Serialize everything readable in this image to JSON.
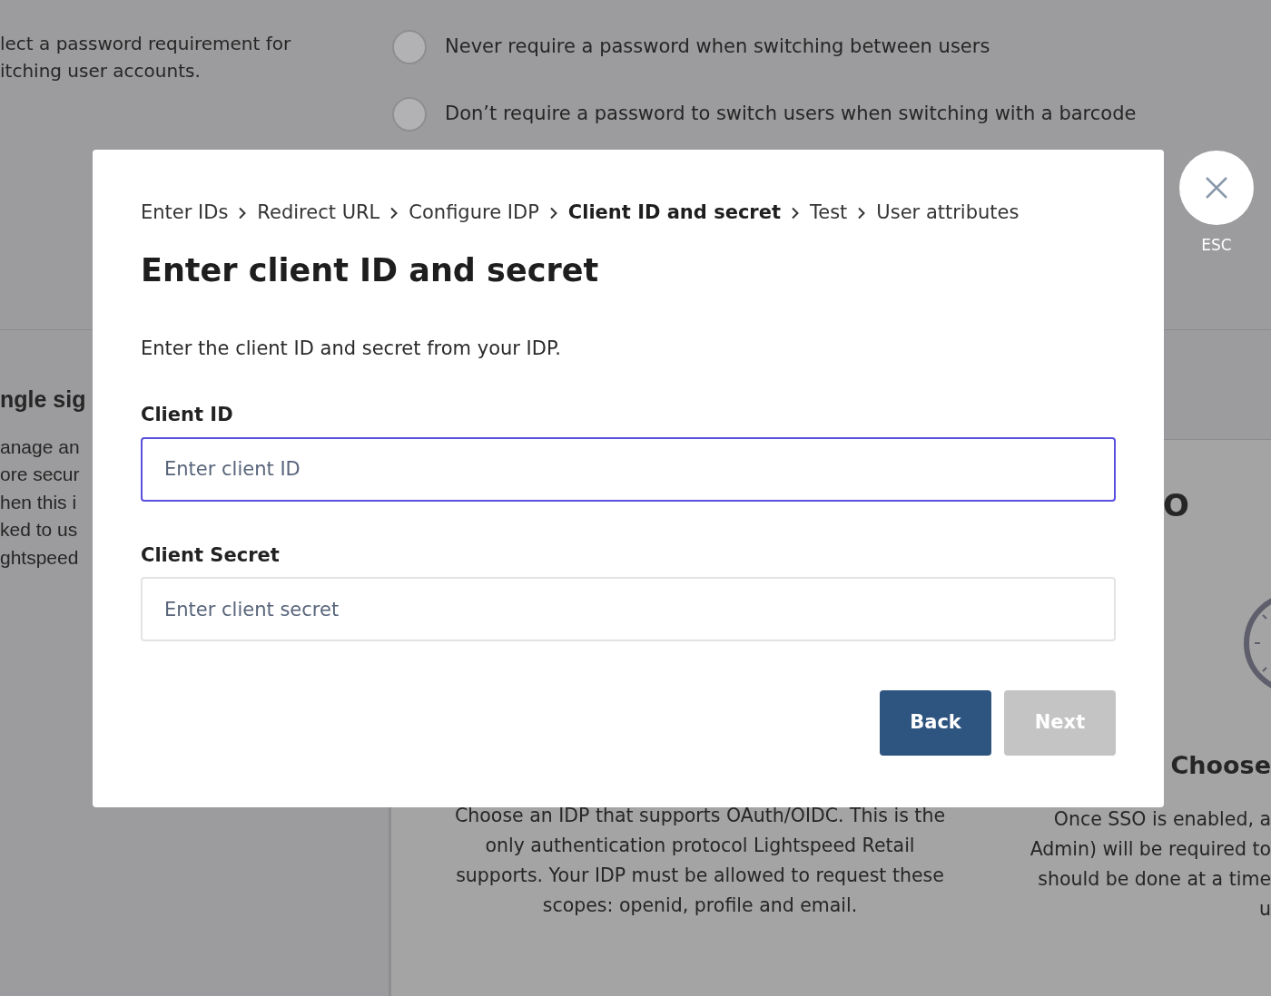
{
  "background": {
    "description_lines": [
      "lect a password requirement for",
      "itching user accounts."
    ],
    "radio_options": [
      {
        "label": "Never require a password when switching between users",
        "selected": false
      },
      {
        "label": "Don’t require a password to switch users when switching with a barcode",
        "selected": false
      }
    ],
    "sso_section": {
      "heading": "ngle sig",
      "description_lines": [
        "anage an",
        "ore secur",
        "hen this i",
        "ked to us",
        "ghtspeed"
      ]
    },
    "idp_card": {
      "description_lines": [
        "Choose an IDP that supports OAuth/OIDC. This is the",
        "only authentication protocol Lightspeed Retail",
        "supports. Your IDP must be allowed to request these",
        "scopes: openid, profile and email."
      ]
    },
    "enable_card": {
      "heading": "O",
      "subheading": "Choose",
      "description_lines": [
        "Once SSO is enabled, a",
        "Admin) will be required to",
        "should be done at a time",
        "u"
      ]
    }
  },
  "modal": {
    "breadcrumbs": [
      {
        "label": "Enter IDs",
        "selected": false
      },
      {
        "label": "Redirect URL",
        "selected": false
      },
      {
        "label": "Configure IDP",
        "selected": false
      },
      {
        "label": "Client ID and secret",
        "selected": true
      },
      {
        "label": "Test",
        "selected": false
      },
      {
        "label": "User attributes",
        "selected": false
      }
    ],
    "title": "Enter client ID and secret",
    "intro": "Enter the client ID and secret from your IDP.",
    "fields": [
      {
        "label": "Client ID",
        "placeholder": "Enter client ID",
        "focused": true
      },
      {
        "label": "Client Secret",
        "placeholder": "Enter client secret",
        "focused": false
      }
    ],
    "buttons": [
      {
        "label": "Back",
        "kind": "primary",
        "disabled": false
      },
      {
        "label": "Next",
        "kind": "primary",
        "disabled": true
      }
    ]
  },
  "close": {
    "label": "ESC"
  }
}
